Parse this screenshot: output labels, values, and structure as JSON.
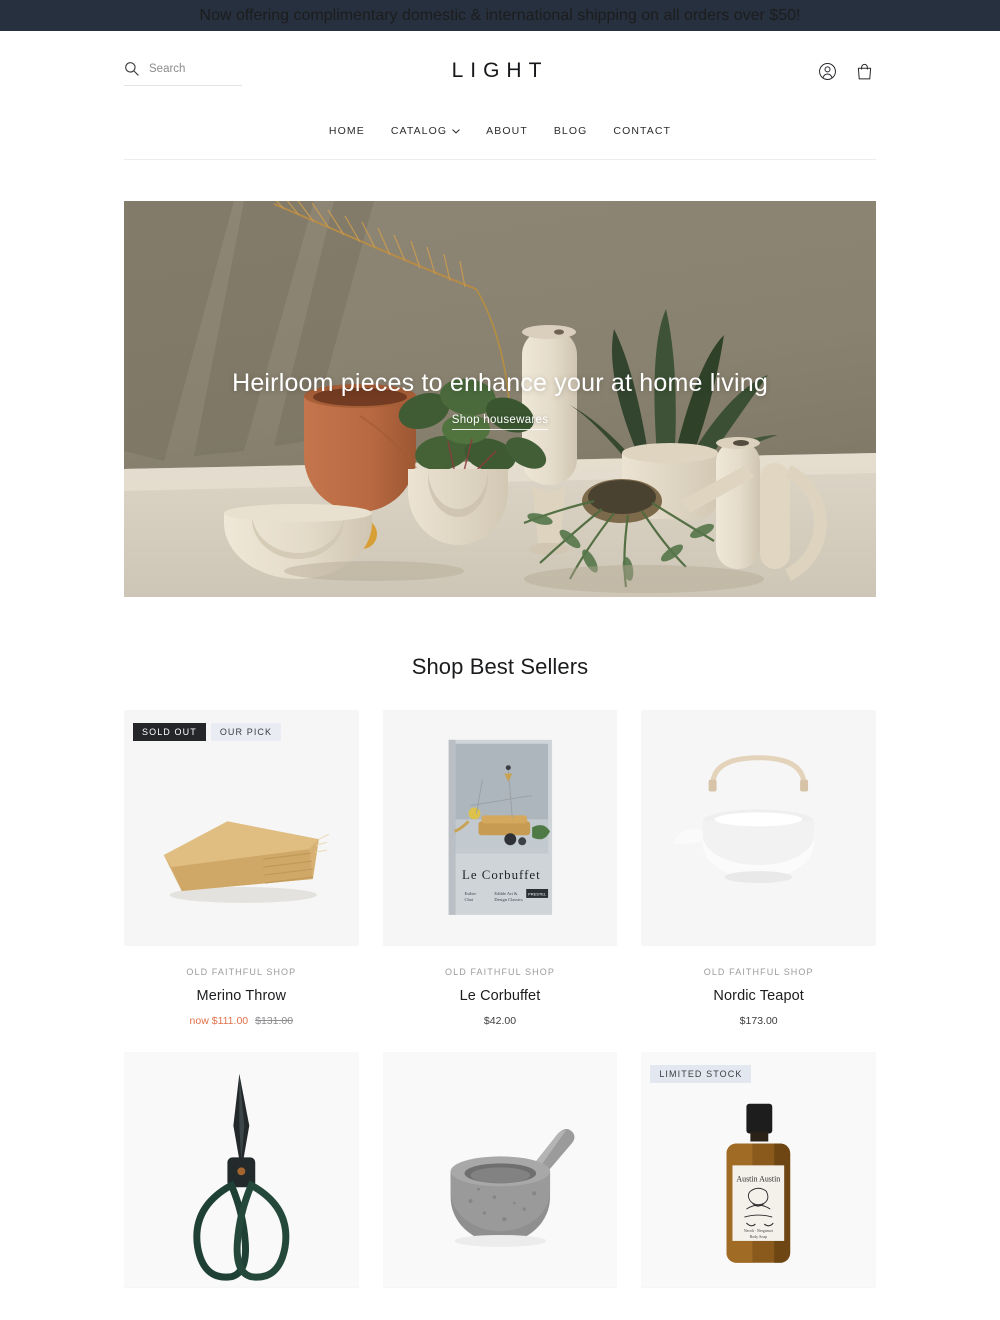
{
  "announcement": {
    "text": "Now offering complimentary domestic & international shipping on all orders over $50!",
    "background": "#27303f"
  },
  "header": {
    "logo": "LIGHT",
    "search": {
      "placeholder": "Search",
      "value": "",
      "icon": "search-icon"
    },
    "actions": [
      {
        "name": "account-icon",
        "label": "Account"
      },
      {
        "name": "cart-icon",
        "label": "Cart"
      }
    ]
  },
  "nav": {
    "items": [
      {
        "label": "HOME",
        "has_dropdown": false
      },
      {
        "label": "CATALOG",
        "has_dropdown": true
      },
      {
        "label": "ABOUT",
        "has_dropdown": false
      },
      {
        "label": "BLOG",
        "has_dropdown": false
      },
      {
        "label": "CONTACT",
        "has_dropdown": false
      }
    ]
  },
  "hero": {
    "title": "Heirloom pieces to enhance your at home living",
    "cta": "Shop housewares",
    "scene": "ceramic vessels, terracotta planter, houseplants and dried palm frond on a taupe backdrop"
  },
  "best_sellers": {
    "title": "Shop Best Sellers",
    "products": [
      {
        "vendor": "OLD FAITHFUL SHOP",
        "title": "Merino Throw",
        "price": "now $111.00",
        "compare_at": "$131.00",
        "on_sale": true,
        "badges": [
          "SOLD OUT",
          "OUR PICK"
        ],
        "image": "folded-camel-wool-throw"
      },
      {
        "vendor": "OLD FAITHFUL SHOP",
        "title": "Le Corbuffet",
        "price": "$42.00",
        "compare_at": "",
        "on_sale": false,
        "badges": [],
        "image": "le-corbuffet-book"
      },
      {
        "vendor": "OLD FAITHFUL SHOP",
        "title": "Nordic Teapot",
        "price": "$173.00",
        "compare_at": "",
        "on_sale": false,
        "badges": [],
        "image": "white-teapot-wood-handle"
      },
      {
        "vendor": "",
        "title": "",
        "price": "",
        "compare_at": "",
        "on_sale": false,
        "badges": [],
        "image": "green-handled-shears"
      },
      {
        "vendor": "",
        "title": "",
        "price": "",
        "compare_at": "",
        "on_sale": false,
        "badges": [],
        "image": "granite-mortar-pestle"
      },
      {
        "vendor": "",
        "title": "",
        "price": "",
        "compare_at": "",
        "on_sale": false,
        "badges": [
          "LIMITED STOCK"
        ],
        "image": "austin-austin-body-soap"
      }
    ]
  },
  "colors": {
    "announcement_bg": "#27303f",
    "sale_price": "#e0714a",
    "badge_dark": "#24262a",
    "badge_light": "#e3e7ef",
    "product_bg": "#f6f6f6"
  }
}
